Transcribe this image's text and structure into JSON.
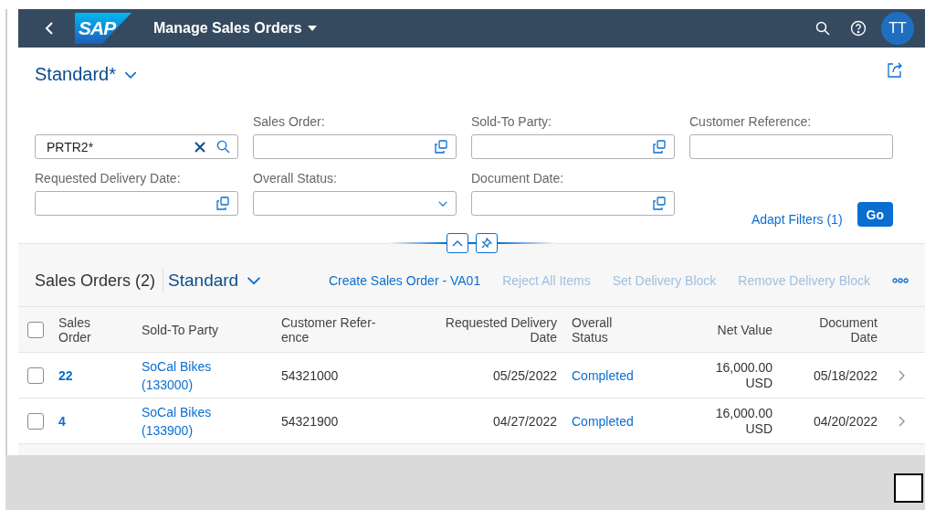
{
  "shell": {
    "title": "Manage Sales Orders",
    "avatar": "TT",
    "logo": "SAP"
  },
  "variant": {
    "label": "Standard*"
  },
  "filters": [
    {
      "kind": "search",
      "value": "PRTR2*"
    },
    {
      "kind": "valuehelp",
      "label": "Sales Order:"
    },
    {
      "kind": "valuehelp",
      "label": "Sold-To Party:"
    },
    {
      "kind": "text",
      "label": "Customer Reference:"
    },
    {
      "kind": "valuehelp",
      "label": "Requested Delivery Date:"
    },
    {
      "kind": "dropdown",
      "label": "Overall Status:"
    },
    {
      "kind": "valuehelp",
      "label": "Document Date:"
    }
  ],
  "filter_actions": {
    "adapt": "Adapt Filters (1)",
    "go": "Go"
  },
  "table": {
    "title": "Sales Orders (2)",
    "variant": "Standard",
    "actions": [
      {
        "label": "Create Sales Order - VA01",
        "disabled": false
      },
      {
        "label": "Reject All Items",
        "disabled": true
      },
      {
        "label": "Set Delivery Block",
        "disabled": true
      },
      {
        "label": "Remove Delivery Block",
        "disabled": true
      }
    ],
    "select_all_checked": false,
    "columns": [
      "Sales Order",
      "Sold-To Party",
      "Customer Refer-ence",
      "Requested Delivery Date",
      "Overall Status",
      "Net Value",
      "Document Date"
    ],
    "rows": [
      {
        "checked": false,
        "sales_order": "22",
        "sold_to_party": "SoCal Bikes (133000)",
        "customer_reference": "54321000",
        "requested_delivery_date": "05/25/2022",
        "overall_status": "Completed",
        "net_value": "16,000.00 USD",
        "document_date": "05/18/2022"
      },
      {
        "checked": false,
        "sales_order": "4",
        "sold_to_party": "SoCal Bikes (133900)",
        "customer_reference": "54321900",
        "requested_delivery_date": "04/27/2022",
        "overall_status": "Completed",
        "net_value": "16,000.00 USD",
        "document_date": "04/20/2022"
      }
    ]
  }
}
